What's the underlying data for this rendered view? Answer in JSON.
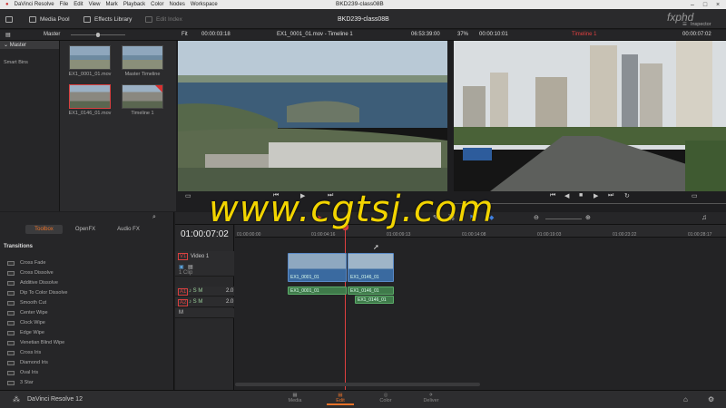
{
  "menubar": {
    "items": [
      "DaVinci Resolve",
      "File",
      "Edit",
      "View",
      "Mark",
      "Playback",
      "Color",
      "Nodes",
      "Workspace"
    ],
    "title": "BKD239-class08B"
  },
  "toolbar": {
    "media_pool": "Media Pool",
    "effects_library": "Effects Library",
    "edit_index": "Edit Index",
    "project_title": "BKD239-class08B",
    "inspector": "Inspector",
    "watermark_logo": "fxphd"
  },
  "subbar": {
    "master": "Master",
    "fit": "Fit",
    "source_tc": "00:00:03:18",
    "source_clip": "EX1_0001_01.mov - Timeline 1",
    "source_dur": "06:53:39:00",
    "zoom": "37%",
    "program_tc": "00:00:10:01",
    "timeline_name": "Timeline 1",
    "program_dur": "00:00:07:02"
  },
  "bins": {
    "master": "Master",
    "smart_bins": "Smart Bins"
  },
  "media": [
    {
      "name": "EX1_0001_01.mov"
    },
    {
      "name": "Master Timeline"
    },
    {
      "name": "EX1_0146_01.mov"
    },
    {
      "name": "Timeline 1"
    }
  ],
  "effects": {
    "tabs": [
      "Toolbox",
      "OpenFX",
      "Audio FX"
    ],
    "section": "Transitions",
    "items": [
      "Cross Fade",
      "Cross Dissolve",
      "Additive Dissolve",
      "Dip To Color Dissolve",
      "Smooth Cut",
      "Center Wipe",
      "Clock Wipe",
      "Edge Wipe",
      "Venetian Blind Wipe",
      "Cross Iris",
      "Diamond Iris",
      "Oval Iris",
      "3 Star"
    ]
  },
  "timeline": {
    "timecode": "01:00:07:02",
    "ruler": [
      "01:00:00:00",
      "01:00:04:16",
      "01:00:09:13",
      "01:00:14:08",
      "01:00:19:03",
      "01:00:23:22",
      "01:00:28:17"
    ],
    "tracks": [
      {
        "id": "V1",
        "name": "Video 1"
      },
      {
        "id": "A1",
        "level": "2.0"
      },
      {
        "id": "A2",
        "level": "2.0"
      },
      {
        "id": "M"
      }
    ],
    "clip_count": "1 Clip",
    "clips": {
      "v1": "EX1_0001_01",
      "v2": "EX1_0146_01",
      "a1": "EX1_0001_01",
      "a1b": "EX1_0146_01",
      "a2": "EX1_0146_01"
    }
  },
  "bottom": {
    "app": "DaVinci Resolve 12",
    "pages": [
      "Media",
      "Edit",
      "Color",
      "Deliver"
    ]
  },
  "watermark": "www.cgtsj.com"
}
